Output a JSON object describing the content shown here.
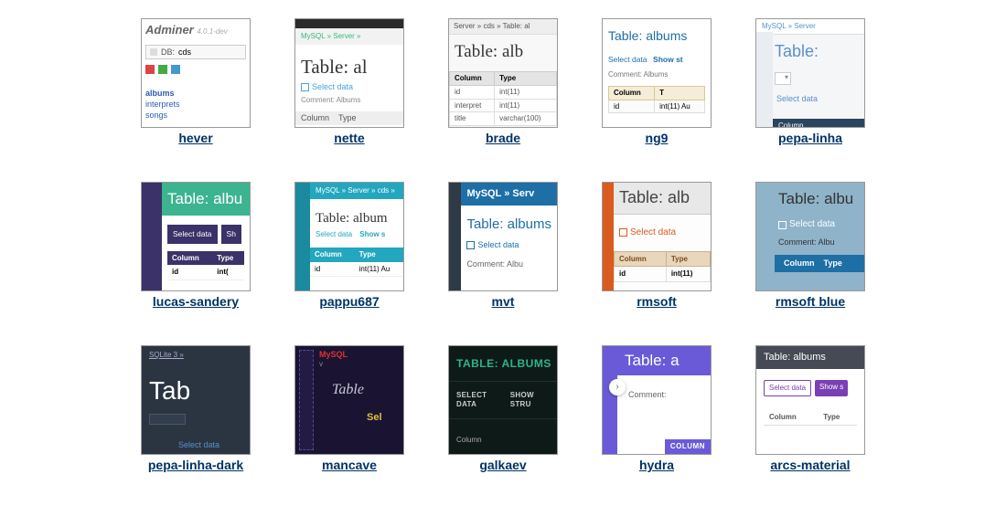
{
  "themes": [
    {
      "id": "hever",
      "caption": "hever",
      "title": "Adminer",
      "version": "4.0.1-dev",
      "db_label": "DB:",
      "db_value": "cds",
      "nav": [
        "albums",
        "interprets",
        "songs"
      ]
    },
    {
      "id": "nette",
      "caption": "nette",
      "crumb": "MySQL » Server »",
      "title": "Table: al",
      "select_data": "Select data",
      "comment": "Comment: Albums",
      "col": "Column",
      "type": "Type"
    },
    {
      "id": "brade",
      "caption": "brade",
      "crumb": "Server » cds » Table: al",
      "title": "Table: alb",
      "col": "Column",
      "type": "Type",
      "rows": [
        [
          "id",
          "int(11)"
        ],
        [
          "interpret",
          "int(11)"
        ],
        [
          "title",
          "varchar(100)"
        ]
      ]
    },
    {
      "id": "ng9",
      "caption": "ng9",
      "title": "Table: albums",
      "select_data": "Select data",
      "show": "Show st",
      "comment": "Comment: Albums",
      "col": "Column",
      "type": "T",
      "row": [
        "id",
        "int(11) Au"
      ]
    },
    {
      "id": "pepa-linha",
      "caption": "pepa-linha",
      "crumb": "MySQL » Server",
      "title": "Table:",
      "select_data": "Select data",
      "thead": "Column"
    },
    {
      "id": "lucas-sandery",
      "caption": "lucas-sandery",
      "title": "Table: albu",
      "select_data": "Select data",
      "show": "Sh",
      "col": "Column",
      "type": "Type",
      "row": [
        "id",
        "int("
      ]
    },
    {
      "id": "pappu687",
      "caption": "pappu687",
      "crumb": "MySQL » Server » cds »",
      "title": "Table: album",
      "select_data": "Select data",
      "show": "Show s",
      "col": "Column",
      "type": "Type",
      "row": [
        "id",
        "int(11) Au"
      ]
    },
    {
      "id": "mvt",
      "caption": "mvt",
      "crumb": "MySQL » Serv",
      "title": "Table: albums",
      "select_data": "Select data",
      "comment": "Comment: Albu"
    },
    {
      "id": "rmsoft",
      "caption": "rmsoft",
      "title": "Table: alb",
      "select_data": "Select data",
      "col": "Column",
      "type": "Type",
      "row": [
        "id",
        "int(11)"
      ]
    },
    {
      "id": "rmsoft-blue",
      "caption": "rmsoft blue",
      "title": "Table: albu",
      "select_data": "Select data",
      "comment": "Comment: Albu",
      "col": "Column",
      "type": "Type"
    },
    {
      "id": "pepa-linha-dark",
      "caption": "pepa-linha-dark",
      "crumb": "SQLite 3 »",
      "title": "Tab",
      "select_data": "Select data"
    },
    {
      "id": "mancave",
      "caption": "mancave",
      "crumb": "MySQL",
      "v": "v",
      "title": "Table",
      "sd": "Sel"
    },
    {
      "id": "galkaev",
      "caption": "galkaev",
      "title": "TABLE: ALBUMS",
      "select_data": "SELECT DATA",
      "show": "SHOW STRU",
      "col": "Column"
    },
    {
      "id": "hydra",
      "caption": "hydra",
      "title": "Table: a",
      "comment": "Comment:",
      "thead": "COLUMN"
    },
    {
      "id": "arcs-material",
      "caption": "arcs-material",
      "title": "Table: albums",
      "select_data": "Select data",
      "show": "Show s",
      "col": "Column",
      "type": "Type"
    }
  ]
}
